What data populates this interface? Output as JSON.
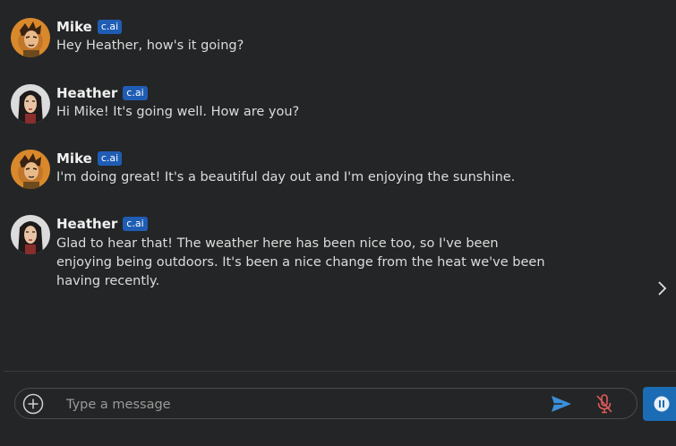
{
  "badge_label": "c.ai",
  "messages": [
    {
      "author": "Mike",
      "text": "Hey Heather, how's it going?"
    },
    {
      "author": "Heather",
      "text": "Hi Mike! It's going well. How are you?"
    },
    {
      "author": "Mike",
      "text": "I'm doing great! It's a beautiful day out and I'm enjoying the sunshine."
    },
    {
      "author": "Heather",
      "text": "Glad to hear that! The weather here has been nice too, so I've been enjoying being outdoors. It's been a nice change from the heat we've been having recently."
    }
  ],
  "composer": {
    "placeholder": "Type a message"
  },
  "icons": {
    "add": "plus-circle-icon",
    "send": "send-icon",
    "mic": "mic-off-icon",
    "pause": "pause-icon",
    "next": "chevron-right-icon"
  },
  "colors": {
    "background": "#242526",
    "badge": "#1f5db4",
    "send": "#3b8fd9",
    "mic_off": "#e05a5a",
    "pause_button": "#1b6bb5"
  }
}
